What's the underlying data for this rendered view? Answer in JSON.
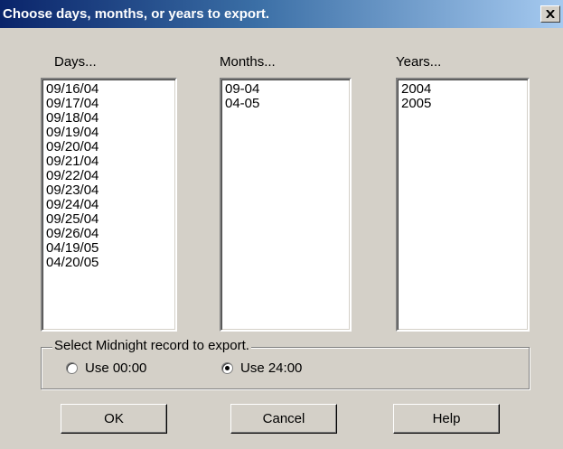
{
  "dialog": {
    "title": "Choose days, months, or years to export."
  },
  "days": {
    "label": "Days...",
    "items": [
      "09/16/04",
      "09/17/04",
      "09/18/04",
      "09/19/04",
      "09/20/04",
      "09/21/04",
      "09/22/04",
      "09/23/04",
      "09/24/04",
      "09/25/04",
      "09/26/04",
      "04/19/05",
      "04/20/05"
    ]
  },
  "months": {
    "label": "Months...",
    "items": [
      "09-04",
      "04-05"
    ]
  },
  "years": {
    "label": "Years...",
    "items": [
      "2004",
      "2005"
    ]
  },
  "midnight": {
    "legend": "Select Midnight record to export.",
    "option1": "Use 00:00",
    "option2": "Use 24:00",
    "selected": "Use 24:00"
  },
  "buttons": {
    "ok": "OK",
    "cancel": "Cancel",
    "help": "Help"
  }
}
